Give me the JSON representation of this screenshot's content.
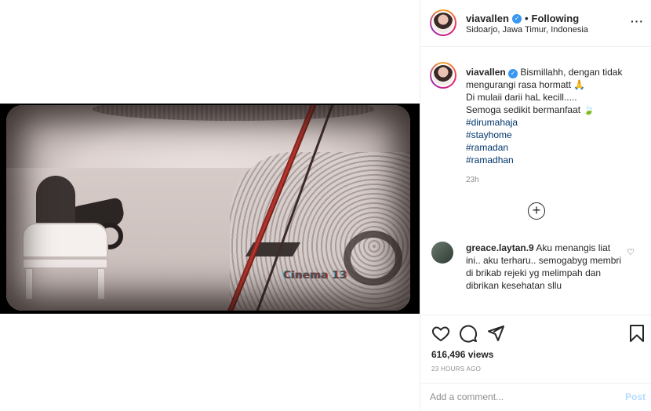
{
  "post": {
    "username": "viavallen",
    "separator": "•",
    "follow_status": "Following",
    "location": "Sidoarjo, Jawa Timur, Indonesia"
  },
  "media": {
    "watermark": "Cinema 13"
  },
  "caption": {
    "username": "viavallen",
    "lines": [
      "Bismillahh, dengan tidak mengurangi rasa hormatt 🙏",
      "Di mulaii darii haL kecill.....",
      "Semoga sedikit bermanfaat 🍃"
    ],
    "hashtags": [
      "#dirumahaja",
      "#stayhome",
      "#ramadan",
      "#ramadhan"
    ],
    "time": "23h"
  },
  "comment": {
    "username": "greace.laytan.9",
    "text": "Aku menangis liat ini.. aku terharu.. semogabyg membri di brikab rejeki yg melimpah dan dibrikan kesehatan sllu"
  },
  "stats": {
    "views": "616,496 views",
    "posted": "23 HOURS AGO"
  },
  "comment_box": {
    "placeholder": "Add a comment...",
    "post_label": "Post"
  },
  "icons": {
    "more": "more-options-icon",
    "verified": "verified-badge-icon",
    "add": "plus-circle-icon",
    "like": "heart-icon",
    "comment": "comment-icon",
    "share": "send-icon",
    "save": "bookmark-icon",
    "comment_like": "small-heart-icon"
  },
  "colors": {
    "verified": "#3897f0",
    "hashtag": "#003569",
    "post_button_disabled": "#b3dbff",
    "muted": "#8e8e8e"
  }
}
